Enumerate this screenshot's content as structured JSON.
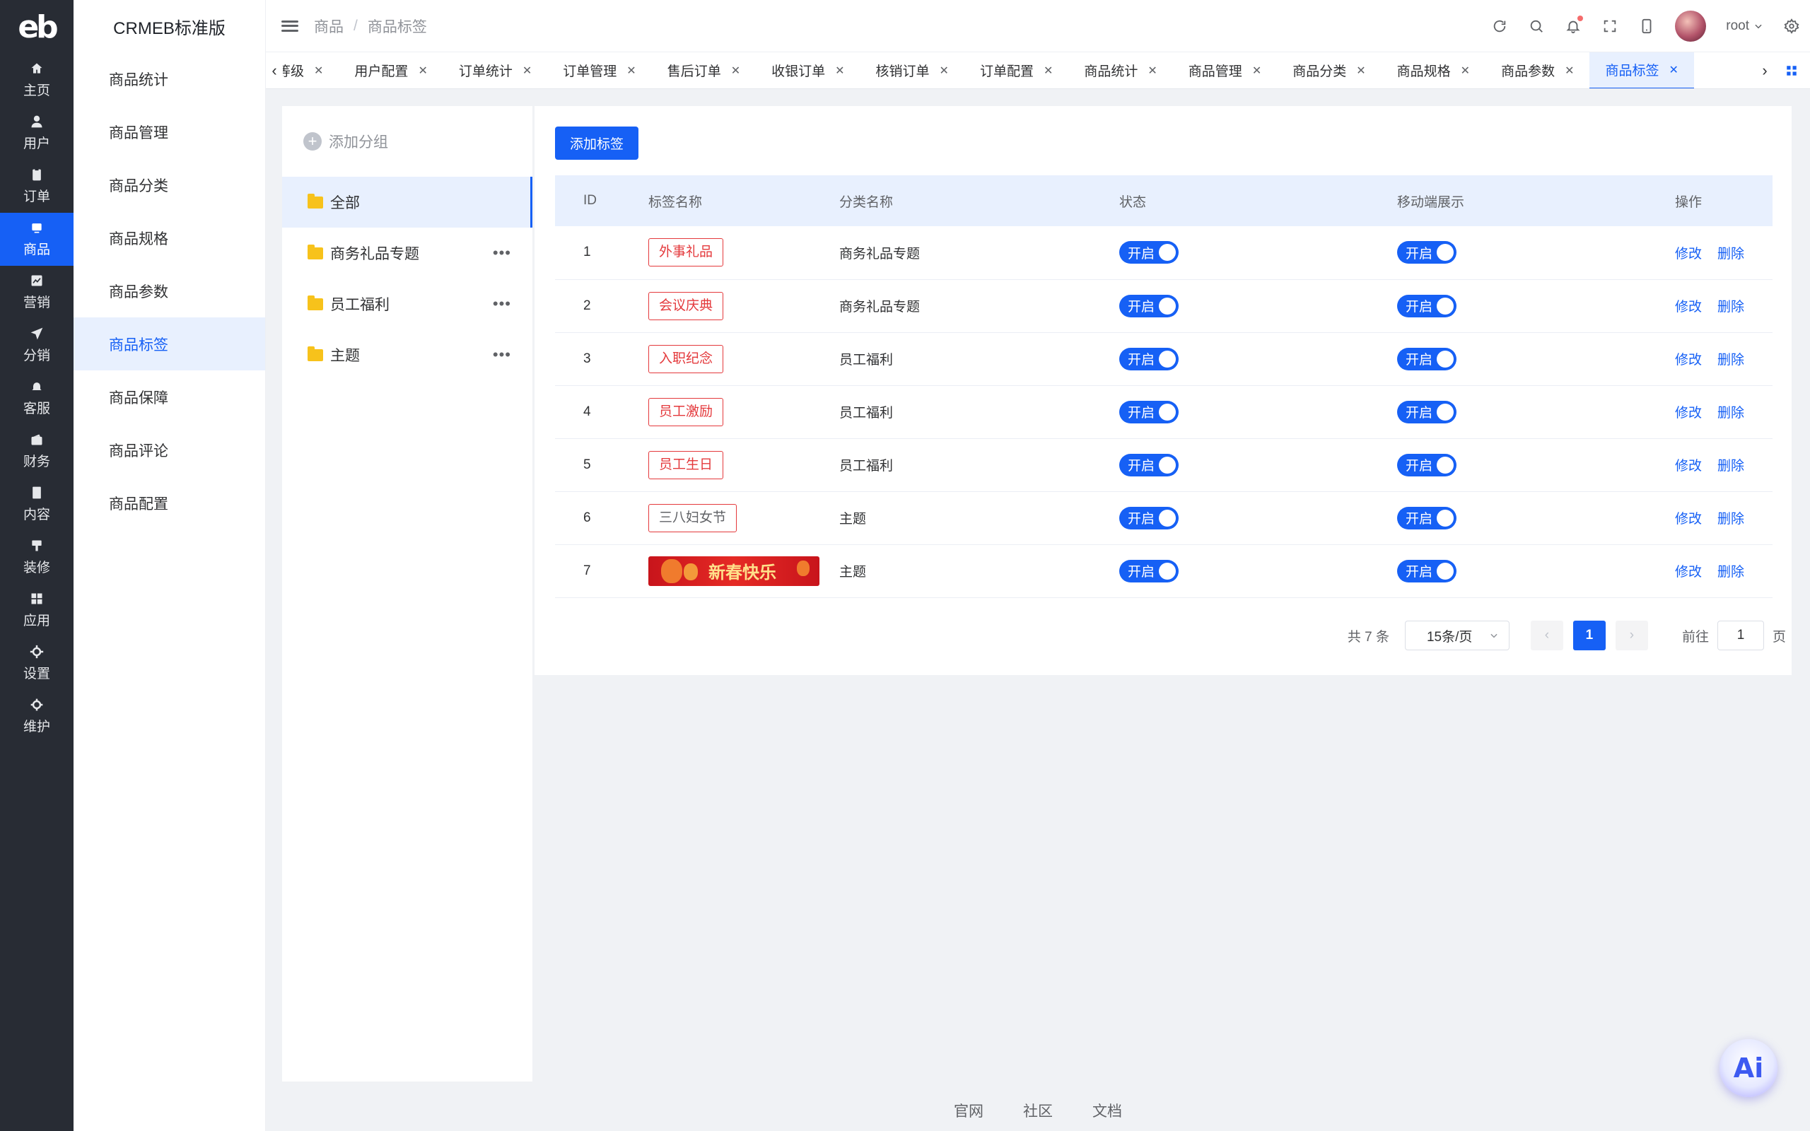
{
  "rail": {
    "logo": "eb",
    "items": [
      {
        "label": "主页",
        "icon": "home-icon"
      },
      {
        "label": "用户",
        "icon": "user-icon"
      },
      {
        "label": "订单",
        "icon": "order-icon"
      },
      {
        "label": "商品",
        "icon": "product-icon",
        "active": true
      },
      {
        "label": "营销",
        "icon": "marketing-icon"
      },
      {
        "label": "分销",
        "icon": "distribution-icon"
      },
      {
        "label": "客服",
        "icon": "service-icon"
      },
      {
        "label": "财务",
        "icon": "finance-icon"
      },
      {
        "label": "内容",
        "icon": "content-icon"
      },
      {
        "label": "装修",
        "icon": "decorate-icon"
      },
      {
        "label": "应用",
        "icon": "apps-icon"
      },
      {
        "label": "设置",
        "icon": "settings-icon"
      },
      {
        "label": "维护",
        "icon": "maintain-icon"
      }
    ]
  },
  "menu": {
    "brand": "CRMEB标准版",
    "items": [
      "商品统计",
      "商品管理",
      "商品分类",
      "商品规格",
      "商品参数",
      "商品标签",
      "商品保障",
      "商品评论",
      "商品配置"
    ],
    "active_index": 5
  },
  "header": {
    "breadcrumb": [
      "商品",
      "商品标签"
    ],
    "username": "root",
    "accent": "#1660f5"
  },
  "tabs": {
    "items": [
      "等级",
      "用户配置",
      "订单统计",
      "订单管理",
      "售后订单",
      "收银订单",
      "核销订单",
      "订单配置",
      "商品统计",
      "商品管理",
      "商品分类",
      "商品规格",
      "商品参数",
      "商品标签"
    ],
    "active_index": 13
  },
  "groups": {
    "add_label": "添加分组",
    "items": [
      {
        "label": "全部",
        "active": true
      },
      {
        "label": "商务礼品专题"
      },
      {
        "label": "员工福利"
      },
      {
        "label": "主题"
      }
    ]
  },
  "main": {
    "add_button": "添加标签",
    "columns": [
      "ID",
      "标签名称",
      "分类名称",
      "状态",
      "移动端展示",
      "操作"
    ],
    "rows": [
      {
        "id": "1",
        "name": "外事礼品",
        "category": "商务礼品专题",
        "status": "开启",
        "mobile": "开启"
      },
      {
        "id": "2",
        "name": "会议庆典",
        "category": "商务礼品专题",
        "status": "开启",
        "mobile": "开启"
      },
      {
        "id": "3",
        "name": "入职纪念",
        "category": "员工福利",
        "status": "开启",
        "mobile": "开启"
      },
      {
        "id": "4",
        "name": "员工激励",
        "category": "员工福利",
        "status": "开启",
        "mobile": "开启"
      },
      {
        "id": "5",
        "name": "员工生日",
        "category": "员工福利",
        "status": "开启",
        "mobile": "开启"
      },
      {
        "id": "6",
        "name": "三八妇女节",
        "category": "主题",
        "status": "开启",
        "mobile": "开启"
      },
      {
        "id": "7",
        "name": "新春快乐",
        "category": "主题",
        "status": "开启",
        "mobile": "开启",
        "is_image": true
      }
    ],
    "edit_label": "修改",
    "delete_label": "删除",
    "pagination": {
      "total": "共 7 条",
      "page_size": "15条/页",
      "current_page": "1",
      "goto_label": "前往",
      "goto_value": "1",
      "page_suffix": "页"
    }
  },
  "footer": {
    "links": [
      "官网",
      "社区",
      "文档"
    ]
  },
  "ai_button": "Ai"
}
